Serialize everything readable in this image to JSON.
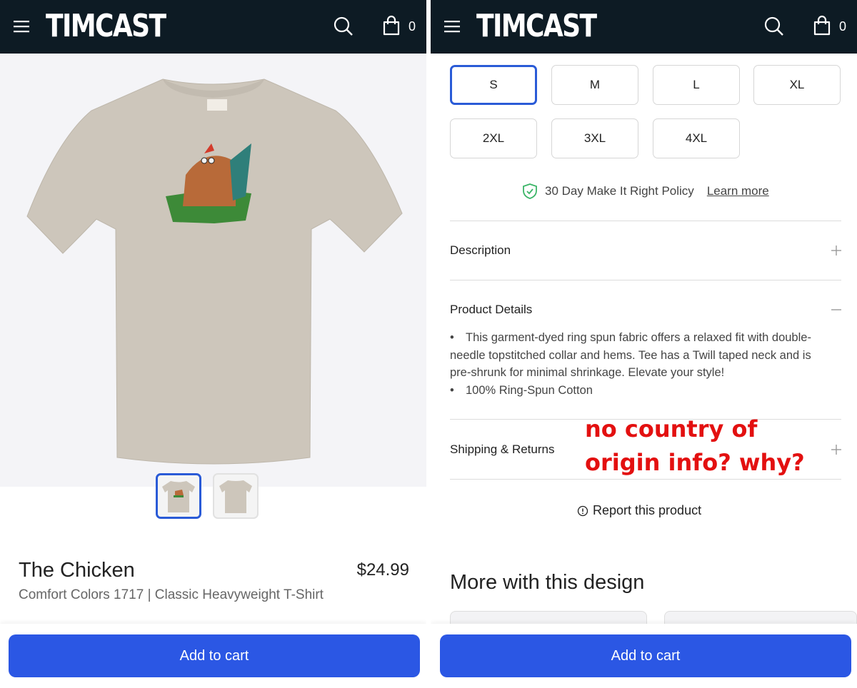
{
  "brand": {
    "logo": "TIMCAST",
    "cart_count": "0"
  },
  "left": {
    "product_title": "The Chicken",
    "price": "$24.99",
    "subtitle": "Comfort Colors 1717 | Classic Heavyweight T-Shirt",
    "add_to_cart": "Add to cart"
  },
  "right": {
    "sizes": [
      "S",
      "M",
      "L",
      "XL",
      "2XL",
      "3XL",
      "4XL"
    ],
    "selected_size": "S",
    "policy_text": "30 Day Make It Right Policy",
    "policy_link": "Learn more",
    "accordion": {
      "description": "Description",
      "product_details": "Product Details",
      "shipping": "Shipping & Returns"
    },
    "details": {
      "item1": "This garment-dyed ring spun fabric offers a relaxed fit with double-needle topstitched collar and hems. Tee has a Twill taped neck and is pre-shrunk for minimal shrinkage. Elevate your style!",
      "item2": "100% Ring-Spun Cotton"
    },
    "annotation_line1": "no country of",
    "annotation_line2": "origin info? why?",
    "report": "Report this product",
    "more_heading": "More with this design",
    "add_to_cart": "Add to cart"
  },
  "colors": {
    "header": "#0d1b24",
    "accent": "#2b57e4",
    "annotation": "#e31010",
    "shirt": "#cdc6bb",
    "policy_check": "#3bb567"
  },
  "icons": [
    "menu-icon",
    "search-icon",
    "bag-icon",
    "shield-check-icon",
    "plus-icon",
    "minus-icon",
    "info-icon"
  ]
}
